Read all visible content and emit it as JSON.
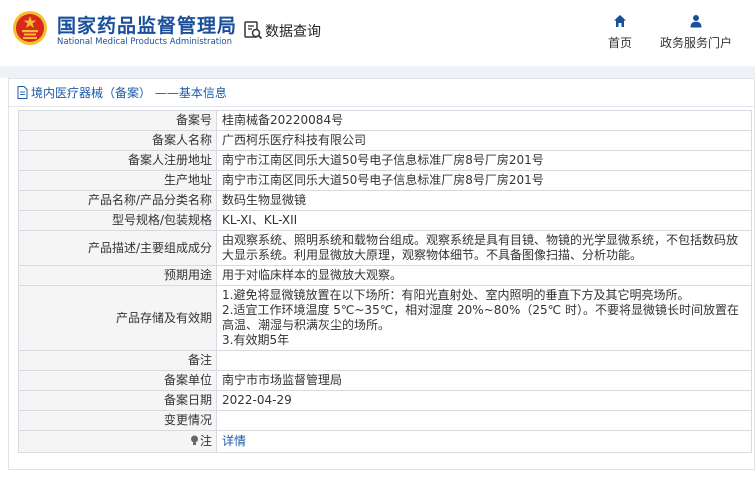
{
  "header": {
    "brand_cn": "国家药品监督管理局",
    "brand_en": "National Medical Products Administration",
    "query_label": "数据查询",
    "nav": {
      "home_label": "首页",
      "portal_label": "政务服务门户"
    }
  },
  "panel": {
    "title": "境内医疗器械（备案） ——基本信息"
  },
  "rows": [
    {
      "label": "备案号",
      "value": "桂南械备20220084号"
    },
    {
      "label": "备案人名称",
      "value": "广西柯乐医疗科技有限公司"
    },
    {
      "label": "备案人注册地址",
      "value": "南宁市江南区同乐大道50号电子信息标准厂房8号厂房201号"
    },
    {
      "label": "生产地址",
      "value": "南宁市江南区同乐大道50号电子信息标准厂房8号厂房201号"
    },
    {
      "label": "产品名称/产品分类名称",
      "value": "数码生物显微镜"
    },
    {
      "label": "型号规格/包装规格",
      "value": "KL-XI、KL-XII"
    },
    {
      "label": "产品描述/主要组成成分",
      "value": "由观察系统、照明系统和载物台组成。观察系统是具有目镜、物镜的光学显微系统，不包括数码放大显示系统。利用显微放大原理，观察物体细节。不具备图像扫描、分析功能。"
    },
    {
      "label": "预期用途",
      "value": "用于对临床样本的显微放大观察。"
    },
    {
      "label": "产品存储及有效期",
      "lines": [
        "1.避免将显微镜放置在以下场所：有阳光直射处、室内照明的垂直下方及其它明亮场所。",
        "2.适宜工作环境温度 5℃~35℃，相对湿度 20%~80%（25℃ 时）。不要将显微镜长时间放置在高温、潮湿与积满灰尘的场所。",
        "3.有效期5年"
      ]
    },
    {
      "label": "备注",
      "value": ""
    },
    {
      "label": "备案单位",
      "value": "南宁市市场监督管理局"
    },
    {
      "label": "备案日期",
      "value": "2022-04-29"
    },
    {
      "label": "变更情况",
      "value": ""
    },
    {
      "label": "注",
      "value": "详情"
    }
  ],
  "colors": {
    "brand_blue": "#1a4f9c",
    "emblem_red": "#d8281b",
    "emblem_gold": "#f3c02b",
    "link_blue": "#1d5aa8",
    "label_bg": "#f5f5f5"
  },
  "icons": {
    "emblem": "national-emblem",
    "query": "search-document-icon",
    "home": "home-icon",
    "portal": "user-icon",
    "panel": "document-icon",
    "note": "lightbulb-icon"
  }
}
